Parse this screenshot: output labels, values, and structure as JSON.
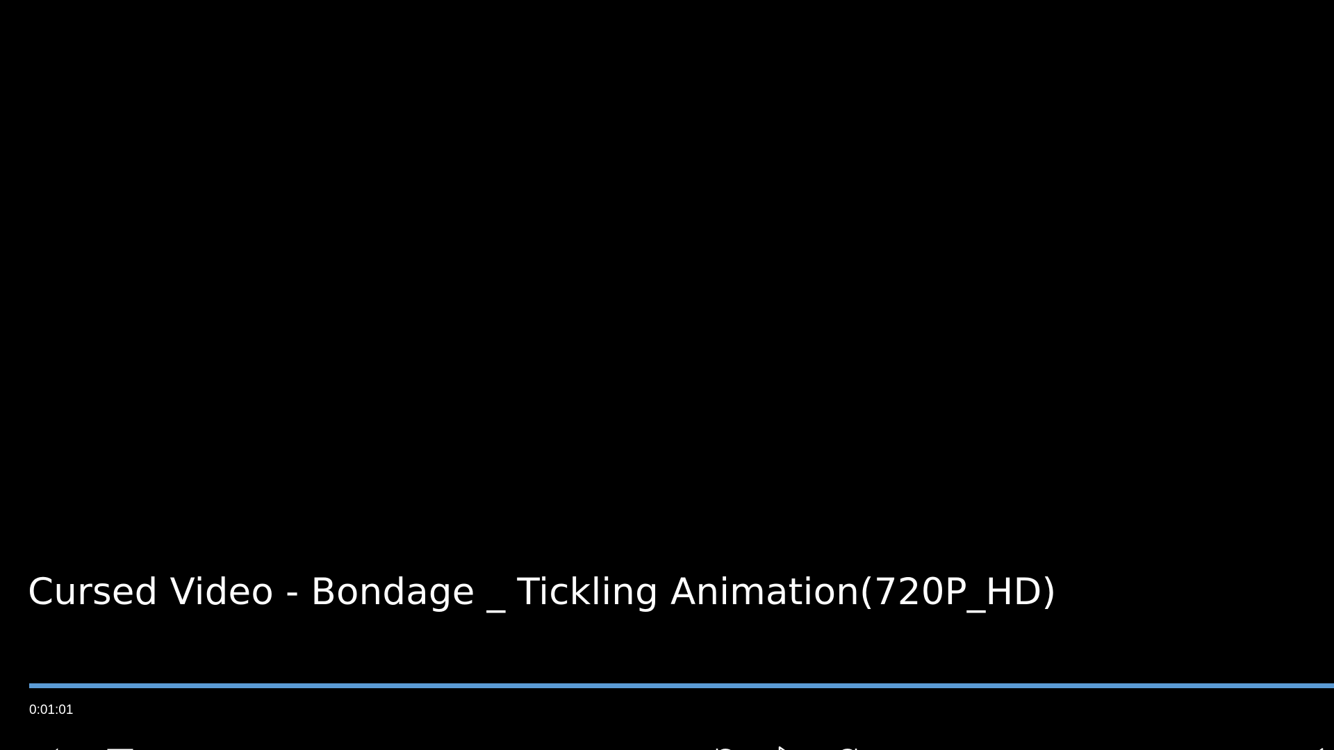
{
  "video": {
    "title": "Cursed Video - Bondage _ Tickling Animation(720P_HD)"
  },
  "playback": {
    "elapsed": "0:01:01",
    "progress_fraction": 1.0
  },
  "colors": {
    "background": "#000000",
    "accent": "#5b9bd5",
    "text": "#ffffff"
  },
  "controls": {
    "volume_icon": "volume-icon",
    "subtitles_icon": "subtitles-icon",
    "skip_back_icon": "skip-back-icon",
    "play_icon": "play-icon",
    "skip_forward_icon": "skip-forward-icon",
    "fullscreen_icon": "fullscreen-icon"
  }
}
